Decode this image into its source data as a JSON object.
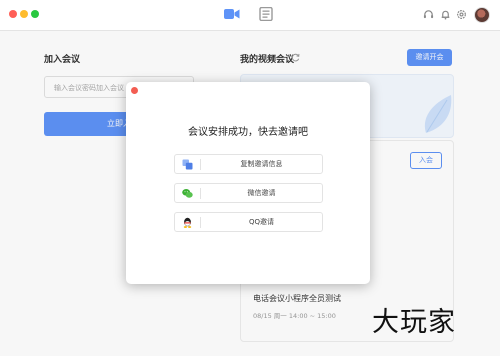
{
  "window": {
    "traffic_lights": [
      "close",
      "minimize",
      "maximize"
    ],
    "tabs": [
      {
        "name": "video-meeting",
        "icon": "video-camera-icon",
        "active": true
      },
      {
        "name": "documents",
        "icon": "document-icon",
        "active": false
      }
    ],
    "toolbar_icons": [
      "headset-icon",
      "bell-icon",
      "gear-icon",
      "avatar"
    ]
  },
  "join": {
    "title": "加入会议",
    "input_placeholder": "输入会议密码加入会议",
    "button_label": "立即入"
  },
  "meetings": {
    "title": "我的视频会议",
    "invite_button": "邀请开会",
    "enter_button": "入会",
    "item": {
      "name": "电话会议小程序全员测试",
      "time": "08/15  周一  14:00 ~ 15:00"
    }
  },
  "dialog": {
    "title": "会议安排成功，快去邀请吧",
    "options": [
      {
        "label": "复制邀请信息",
        "icon": "copy-icon"
      },
      {
        "label": "微信邀请",
        "icon": "wechat-icon"
      },
      {
        "label": "QQ邀请",
        "icon": "qq-icon"
      }
    ]
  },
  "watermark": "大玩家",
  "colors": {
    "accent": "#5e93f7",
    "close_red": "#f35d52",
    "wechat_green": "#3cb034"
  }
}
